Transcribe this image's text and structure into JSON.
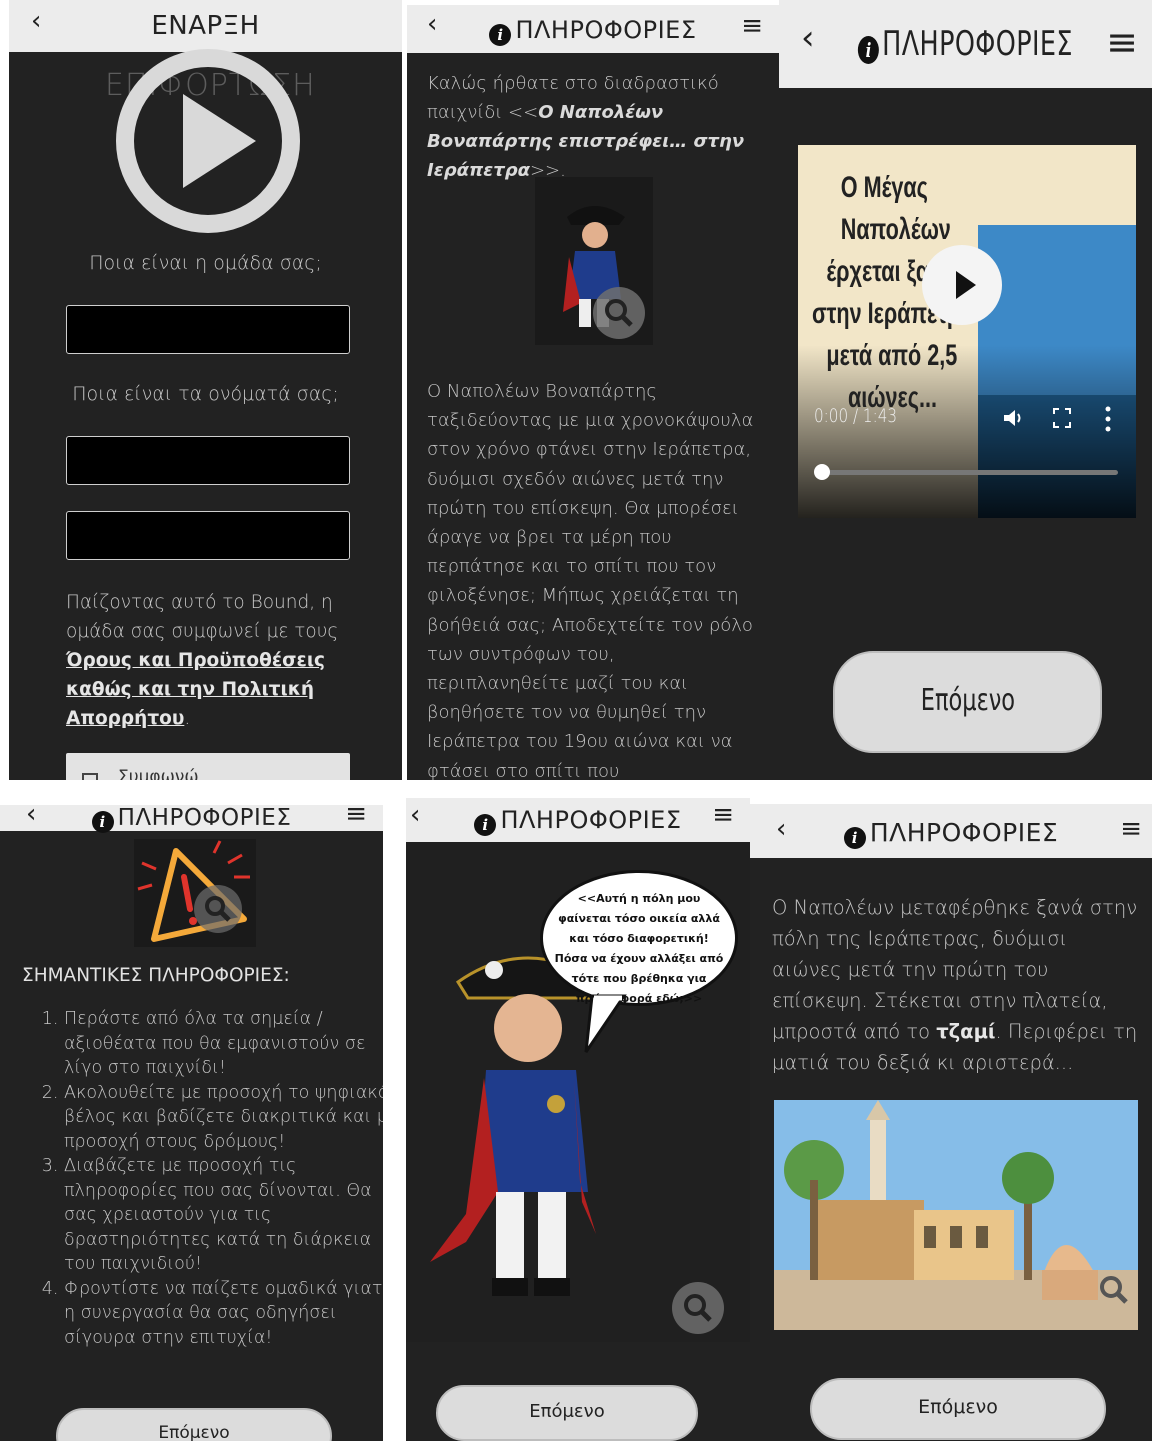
{
  "p1": {
    "header_title": "ΕΝΑΡΞΗ",
    "behind_text": "ΕΠΙΦΟΡΤΩΣΗ",
    "team_question": "Ποια είναι η ομάδα σας;",
    "names_question": "Ποια είναι τα ονόματά σας;",
    "terms_prefix": "Παίζοντας αυτό το Bound, η ομάδα σας συμφωνεί με τους ",
    "terms_link": "Όρους και Προϋποθέσεις καθώς και την Πολιτική Απορρήτου",
    "terms_suffix": ".",
    "cut_button_label": "Συμφωνώ"
  },
  "p2": {
    "header_title": "ΠΛΗΡΟΦΟΡΙΕΣ",
    "intro_prefix": "Καλώς ήρθατε στο διαδραστικό παιχνίδι <<",
    "intro_title": "Ο Ναπολέων Βοναπάρτης επιστρέφει… στην Ιεράπετρα",
    "intro_suffix": ">>.",
    "story": "Ο Ναπολέων Βοναπάρτης ταξιδεύοντας με μια χρονοκάψουλα στον χρόνο φτάνει στην Ιεράπετρα, δυόμισι σχεδόν αιώνες μετά την πρώτη του επίσκεψη. Θα μπορέσει άραγε να βρει τα μέρη που περπάτησε και το σπίτι που τον φιλοξένησε; Μήπως χρειάζεται τη βοήθειά σας; Αποδεχτείτε τον ρόλο των συντρόφων του, περιπλανηθείτε μαζί του και βοηθήσετε τον να θυμηθεί την Ιεράπετρα του 19ου αιώνα και να φτάσει στο σπίτι που διανυκτέρευσε."
  },
  "p3": {
    "header_title": "ΠΛΗΡΟΦΟΡΙΕΣ",
    "video_caption_lines": [
      "Ο Μέγας",
      "Ναπολέων",
      "έρχεται ξανά",
      "στην Ιεράπετρα",
      "μετά από 2,5",
      "αιώνες..."
    ],
    "video_time": "0:00 / 1:43",
    "next_label": "Επόμενο"
  },
  "p4": {
    "header_title": "ΠΛΗΡΟΦΟΡΙΕΣ",
    "heading": "ΣΗΜΑΝΤΙΚΕΣ ΠΛΗΡΟΦΟΡΙΕΣ:",
    "items": [
      "Περάστε από όλα τα σημεία / αξιοθέατα που θα εμφανιστούν σε λίγο στο παιχνίδι!",
      "Ακολουθείτε με προσοχή το ψηφιακό βέλος και βαδίζετε διακριτικά και με προσοχή στους δρόμους!",
      "Διαβάζετε με προσοχή τις πληροφορίες που σας δίνονται. Θα σας χρειαστούν για τις δραστηριότητες κατά τη διάρκεια του παιχνιδιού!",
      "Φροντίστε να παίζετε ομαδικά γιατί η συνεργασία θα σας οδηγήσει σίγουρα στην επιτυχία!"
    ],
    "next_label": "Επόμενο"
  },
  "p5": {
    "header_title": "ΠΛΗΡΟΦΟΡΙΕΣ",
    "speech": "<<Αυτή η πόλη μου φαίνεται τόσο οικεία αλλά και τόσο διαφορετική! Πόσα να έχουν αλλάξει από τότε που βρέθηκα για πρώτη φορά εδώ;>>",
    "next_label": "Επόμενο"
  },
  "p6": {
    "header_title": "ΠΛΗΡΟΦΟΡΙΕΣ",
    "text_prefix": "Ο Ναπολέων μεταφέρθηκε ξανά στην πόλη της Ιεράπετρας, δυόμισι αιώνες μετά την πρώτη του επίσκεψη. Στέκεται στην πλατεία, μπροστά από το ",
    "text_bold": "τζαμί",
    "text_suffix": ". Περιφέρει τη ματιά του δεξιά κι αριστερά...",
    "next_label": "Επόμενο"
  },
  "icons": {
    "back": "chevron-left-icon",
    "menu": "hamburger-menu-icon",
    "info": "info-icon",
    "zoom": "magnifier-icon",
    "play": "play-icon",
    "warning": "warning-icon"
  },
  "colors": {
    "panel_bg": "#222222",
    "header_bg": "#ececec",
    "button_bg": "#dcdcdc",
    "warning_accent": "#f4a93a",
    "alert_red": "#e0342c"
  }
}
